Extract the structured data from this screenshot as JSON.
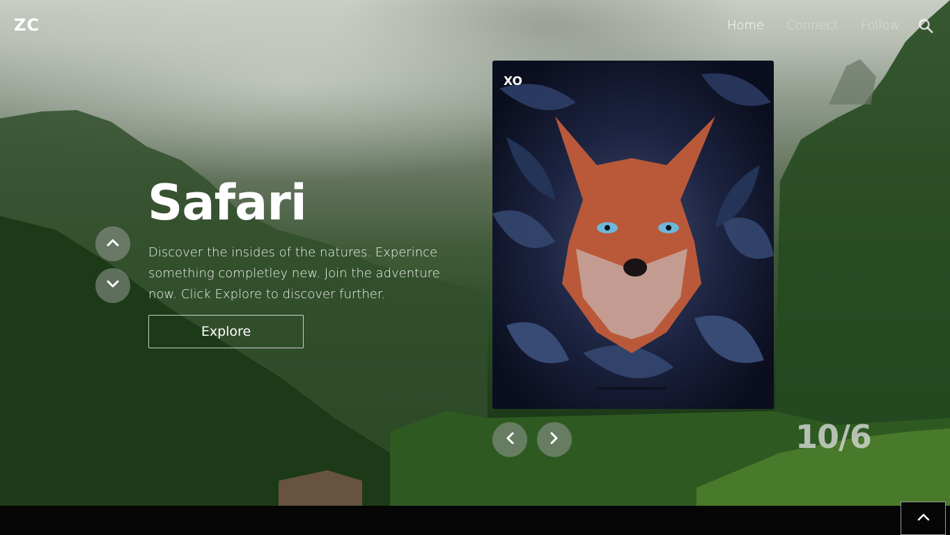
{
  "brand": {
    "logo": "ZC"
  },
  "nav": {
    "items": [
      {
        "label": "Home",
        "active": true
      },
      {
        "label": "Connect",
        "active": false
      },
      {
        "label": "Follow",
        "active": false
      }
    ],
    "search_icon": "search-icon"
  },
  "hero": {
    "title": "Safari",
    "description": "Discover the insides of the natures. Experince something completley new. Join the adventure now. Click Explore to discover further.",
    "explore_label": "Explore",
    "scroll_up_icon": "chevron-up-icon",
    "scroll_down_icon": "chevron-down-icon"
  },
  "card": {
    "label": "XO",
    "image_subject": "fox-among-blue-leaves"
  },
  "carousel": {
    "prev_icon": "chevron-left-icon",
    "next_icon": "chevron-right-icon",
    "counter": "10/6"
  },
  "back_to_top_icon": "chevron-up-icon",
  "colors": {
    "accent_text": "#ffffff",
    "inactive_nav": "#8a8f88",
    "control_bg": "#969b96",
    "card_bg": "#1c2340"
  }
}
